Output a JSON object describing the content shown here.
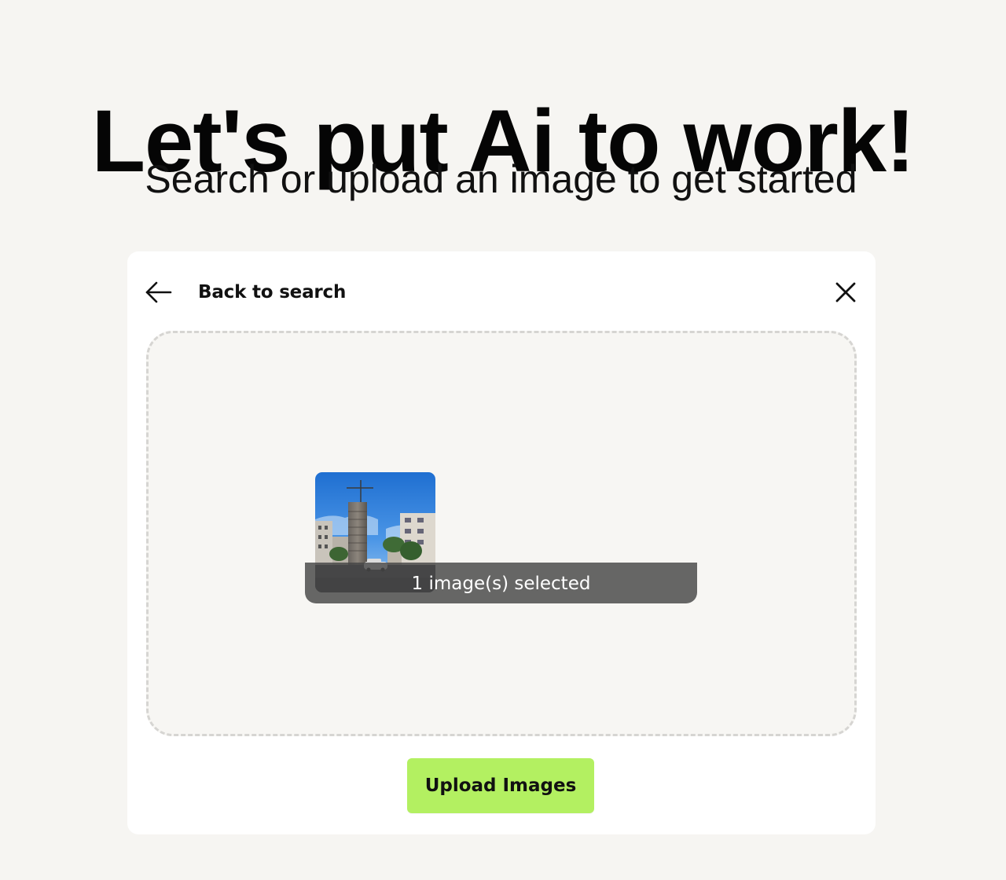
{
  "header": {
    "title": "Let's put Ai to work!",
    "subtitle": "Search or upload an image to get started"
  },
  "panel": {
    "back_label": "Back to search",
    "back_icon": "arrow-left-icon",
    "close_icon": "close-icon",
    "dropzone": {
      "selected_count_text": "1 image(s) selected",
      "thumbnail_alt": "Selected image thumbnail"
    },
    "upload_label": "Upload Images"
  },
  "colors": {
    "page_background": "#f6f5f2",
    "card_background": "#ffffff",
    "dropzone_background": "#f7f6f3",
    "dropzone_border": "#d6d5d2",
    "accent_button": "#b3f061",
    "badge_background": "#464646"
  }
}
